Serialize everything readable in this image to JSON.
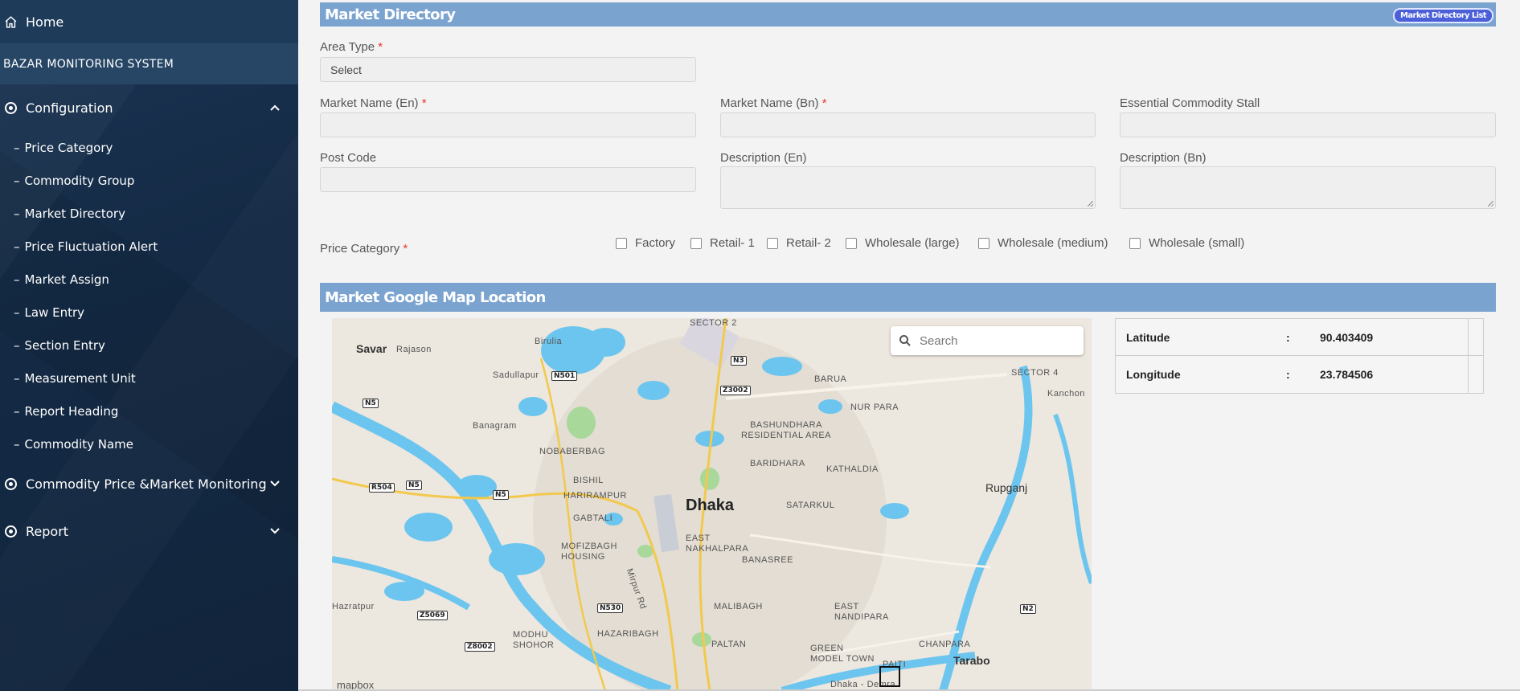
{
  "sidebar": {
    "home_label": "Home",
    "brand": "BAZAR MONITORING SYSTEM",
    "configuration_label": "Configuration",
    "config_items": [
      "Price Category",
      "Commodity Group",
      "Market Directory",
      "Price Fluctuation Alert",
      "Market Assign",
      "Law Entry",
      "Section Entry",
      "Measurement Unit",
      "Report Heading",
      "Commodity Name"
    ],
    "commodity_label": "Commodity Price &Market Monitoring",
    "report_label": "Report"
  },
  "form": {
    "title": "Market Directory",
    "list_button": "Market Directory List",
    "area_type_label": "Area Type",
    "area_type_value": "Select",
    "market_name_en_label": "Market Name (En)",
    "market_name_bn_label": "Market Name (Bn)",
    "essential_stall_label": "Essential Commodity Stall",
    "post_code_label": "Post Code",
    "description_en_label": "Description (En)",
    "description_bn_label": "Description (Bn)",
    "price_category_label": "Price Category",
    "required_mark": "*",
    "price_categories": [
      "Factory",
      "Retail- 1",
      "Retail- 2",
      "Wholesale (large)",
      "Wholesale (medium)",
      "Wholesale (small)"
    ]
  },
  "map_section": {
    "title": "Market Google Map Location",
    "search_placeholder": "Search",
    "attribution": "mapbox",
    "places": {
      "dhaka": "Dhaka",
      "savar": "Savar",
      "rajason": "Rajason",
      "birulia": "Birulia",
      "sadullapur": "Sadullapur",
      "banagram": "Banagram",
      "rupganj": "Rupganj",
      "tarabo": "Tarabo",
      "kanchon": "Kanchon",
      "hazratpur": "Hazratpur",
      "sector2": "SECTOR 2",
      "sector4": "SECTOR 4",
      "barua": "BARUA",
      "nurpara": "NUR PARA",
      "bashundhara": "BASHUNDHARA RESIDENTIAL AREA",
      "baridhara": "BARIDHARA",
      "kathaldia": "KATHALDIA",
      "satarkul": "SATARKUL",
      "nobaberbag": "NOBABERBAG",
      "bishil": "BISHIL",
      "harirampur": "HARIRAMPUR",
      "gabtali": "GABTALI",
      "mofizbagh": "MOFIZBAGH HOUSING",
      "eastnakhal": "EAST NAKHALPARA",
      "banasree": "BANASREE",
      "malibagh": "MALIBAGH",
      "eastnandi": "EAST NANDIPARA",
      "hazaribagh": "HAZARIBAGH",
      "modhu": "MODHU SHOHOR",
      "paltan": "PALTAN",
      "greenmodel": "GREEN MODEL TOWN",
      "chanpara": "CHANPARA",
      "paiti": "PAITI",
      "mirpur": "Mirpur Rd",
      "demra": "Dhaka - Demra"
    },
    "roads": [
      "N501",
      "N3",
      "Z3002",
      "N5",
      "N5",
      "R504",
      "N5",
      "N530",
      "Z5069",
      "Z8002",
      "N2"
    ]
  },
  "coordinates": {
    "latitude_label": "Latitude",
    "latitude_value": "90.403409",
    "longitude_label": "Longitude",
    "longitude_value": "23.784506",
    "separator": ":"
  },
  "colors": {
    "sidebar_bg": "#142a45",
    "section_band": "#7ba3d0",
    "badge": "#4a5fd8",
    "water": "#6cc5ee"
  }
}
